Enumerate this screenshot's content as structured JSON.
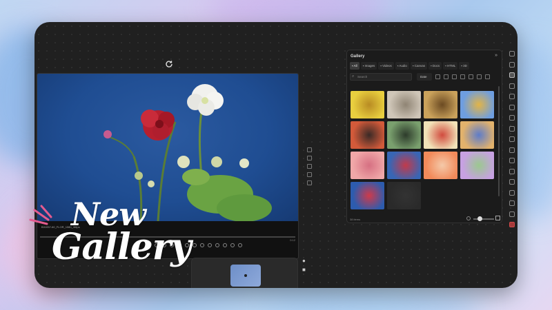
{
  "window": {
    "accent": "#e35b8f"
  },
  "preview": {
    "file_name": "B31057-60_FLOR_1080_30fps",
    "time_end": "0:12"
  },
  "gallery": {
    "title": "Gallery",
    "tabs": [
      {
        "label": "All",
        "icon": "grid-icon",
        "active": true
      },
      {
        "label": "Images",
        "icon": "image-icon"
      },
      {
        "label": "Videos",
        "icon": "video-icon"
      },
      {
        "label": "Audio",
        "icon": "audio-icon"
      },
      {
        "label": "Canvas",
        "icon": "canvas-icon"
      },
      {
        "label": "Docs",
        "icon": "doc-icon"
      },
      {
        "label": "HTML",
        "icon": "code-icon"
      },
      {
        "label": "3D",
        "icon": "cube-icon"
      }
    ],
    "search_placeholder": "Search",
    "sort_label": "Date",
    "item_count": "38 items",
    "thumbnails": [
      {
        "name": "thumb-bee-yellow",
        "colors": [
          "#e9cf3f",
          "#b88b23"
        ]
      },
      {
        "name": "thumb-bee-gray",
        "colors": [
          "#cfc6b8",
          "#8f8474"
        ]
      },
      {
        "name": "thumb-bee-orange",
        "colors": [
          "#caa25b",
          "#6b4a22"
        ]
      },
      {
        "name": "thumb-bee-blue",
        "colors": [
          "#6e9ee0",
          "#e2b447"
        ]
      },
      {
        "name": "thumb-projector",
        "colors": [
          "#d25a3a",
          "#3a2a26"
        ]
      },
      {
        "name": "thumb-theater",
        "colors": [
          "#7aa06e",
          "#2d3b2b"
        ]
      },
      {
        "name": "thumb-popcorn",
        "colors": [
          "#f1e2b8",
          "#d14b3e"
        ]
      },
      {
        "name": "thumb-popcorn-bowl",
        "colors": [
          "#e2b26c",
          "#5e7cc9"
        ]
      },
      {
        "name": "thumb-carnation",
        "colors": [
          "#f0a7a8",
          "#d67082"
        ]
      },
      {
        "name": "thumb-flower-blue",
        "colors": [
          "#3866b5",
          "#c23a4a"
        ]
      },
      {
        "name": "thumb-gerbera",
        "colors": [
          "#f28a5a",
          "#f4c9a9"
        ]
      },
      {
        "name": "thumb-pink-flower",
        "colors": [
          "#c7a1e2",
          "#9bc88f"
        ]
      },
      {
        "name": "thumb-rose-blue",
        "colors": [
          "#2d5cae",
          "#cf3a4a"
        ]
      },
      {
        "name": "thumb-empty",
        "colors": [
          "#2a2a2a",
          "#333333"
        ]
      }
    ]
  },
  "overlay": {
    "line1": "New",
    "line2": "Gallery"
  }
}
